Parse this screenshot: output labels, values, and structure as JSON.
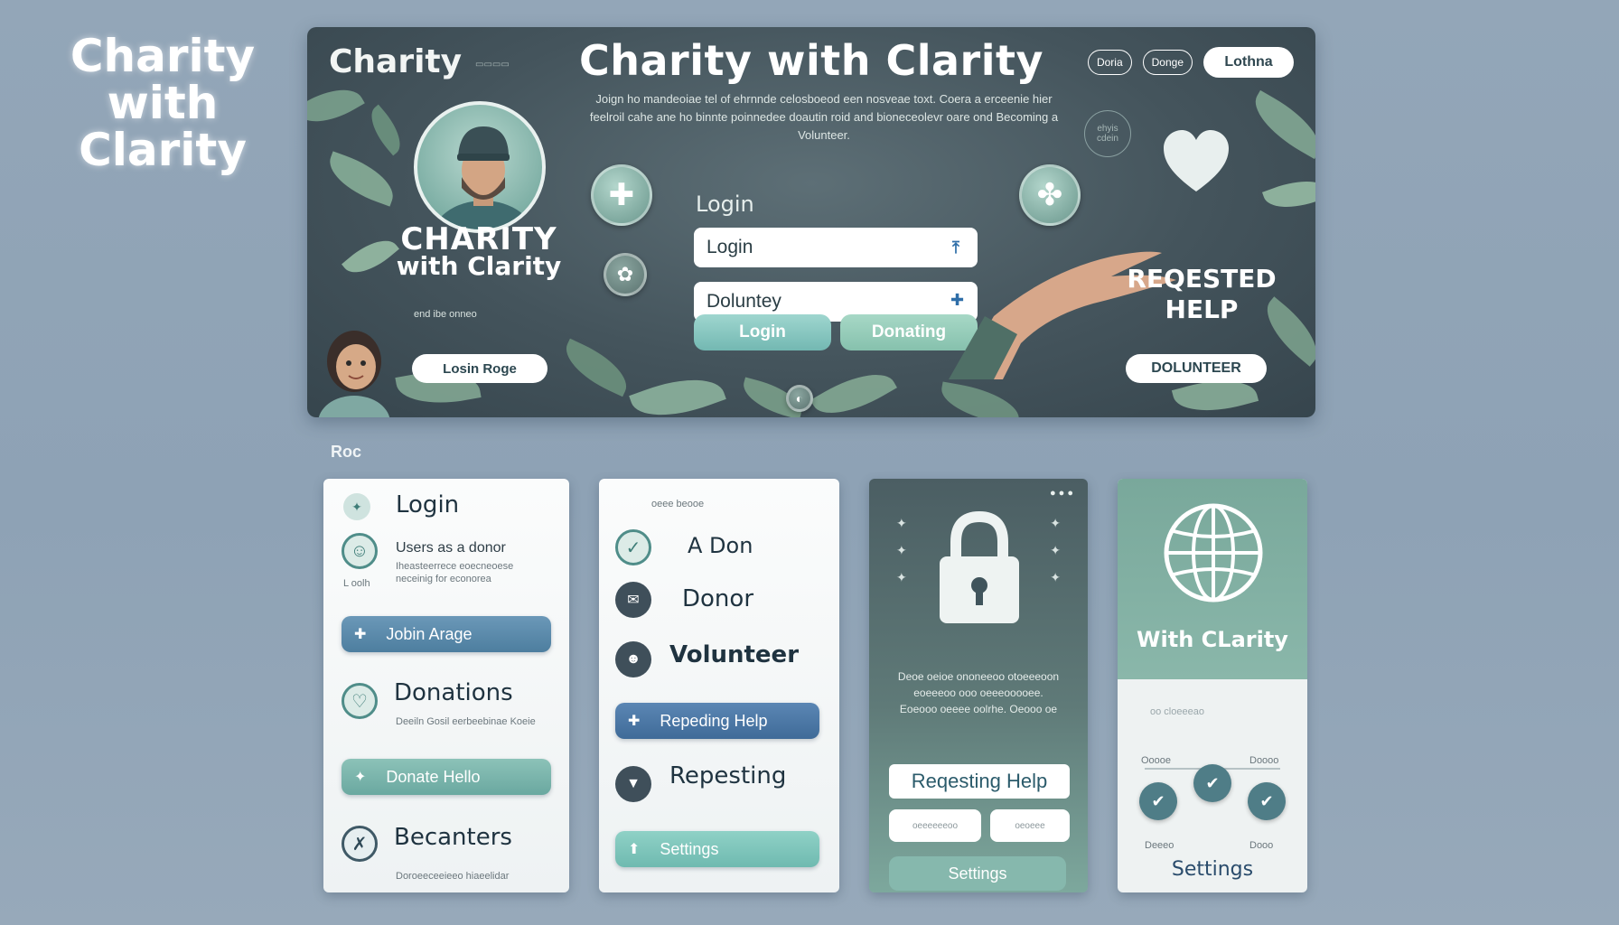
{
  "colors": {
    "background": "#93a6b8",
    "hero_bg": "#44545c",
    "accent_teal": "#7fb6ad",
    "accent_blue": "#5a86a8",
    "text_dark": "#1f3340"
  },
  "corner_logo": {
    "line1": "Charity",
    "line2": "with Clarity"
  },
  "hero": {
    "brand": "Charity",
    "title": "Charity with Clarity",
    "nav": {
      "item1": "Doria",
      "item2": "Donge",
      "login": "Lothna"
    },
    "description": "Joign ho mandeoiae tel of ehrnnde celosboeod een nosveae toxt. Coera a erceenie hier feelroil cahe ane ho binnte poinnedee doautin roid and bioneceolevr oare ond Becoming a Volunteer.",
    "logo_line1": "CHARITY",
    "logo_line2": "with Clarity",
    "small_text": "end ibe onneo",
    "left_button": "Losin Roge",
    "form": {
      "heading": "Login",
      "input1_value": "Login",
      "input2_value": "Doluntey",
      "btn_login": "Login",
      "btn_donate": "Donating"
    },
    "requested_help_line1": "REQESTED",
    "requested_help_line2": "HELP",
    "right_button": "DOLUNTEER",
    "stamp_text": "ehyis cdein"
  },
  "section_label": "Roc",
  "card1": {
    "login_title": "Login",
    "login_sub": "Users as a donor",
    "login_desc": "Iheasteerrece eoecneoese neceinig for econorea",
    "login_tiny": "L oolh",
    "btn1": "Jobin Arage",
    "donations_title": "Donations",
    "donations_desc": "Deeiln Gosil eerbeebinae Koeie",
    "btn2": "Donate Hello",
    "becanters_title": "Becanters",
    "becanters_desc": "Doroeeceeieeo hiaeelidar"
  },
  "card2": {
    "tiny": "oeee beooe",
    "item1": "A Don",
    "item2": "Donor",
    "item3": "Volunteer",
    "btn1": "Repeding Help",
    "item4": "Repesting",
    "btn2": "Settings"
  },
  "card3": {
    "description": "Deoe oeioe ononeeoo otoeeeoon eoeeeoo ooo oeeeooooee. Eoeooo oeeee oolrhe. Oeooo oe",
    "btn_white": "Reqesting Help",
    "pill1": "oeeeeeeoo",
    "pill2": "oeoeee",
    "btn_bottom": "Settings"
  },
  "card4": {
    "title": "With CLarity",
    "tiny_top": "oo cloeeeao",
    "label1": "Ooooe",
    "label2": "Doooo",
    "label3": "Deeeo",
    "label4": "Dooo",
    "settings": "Settings"
  }
}
